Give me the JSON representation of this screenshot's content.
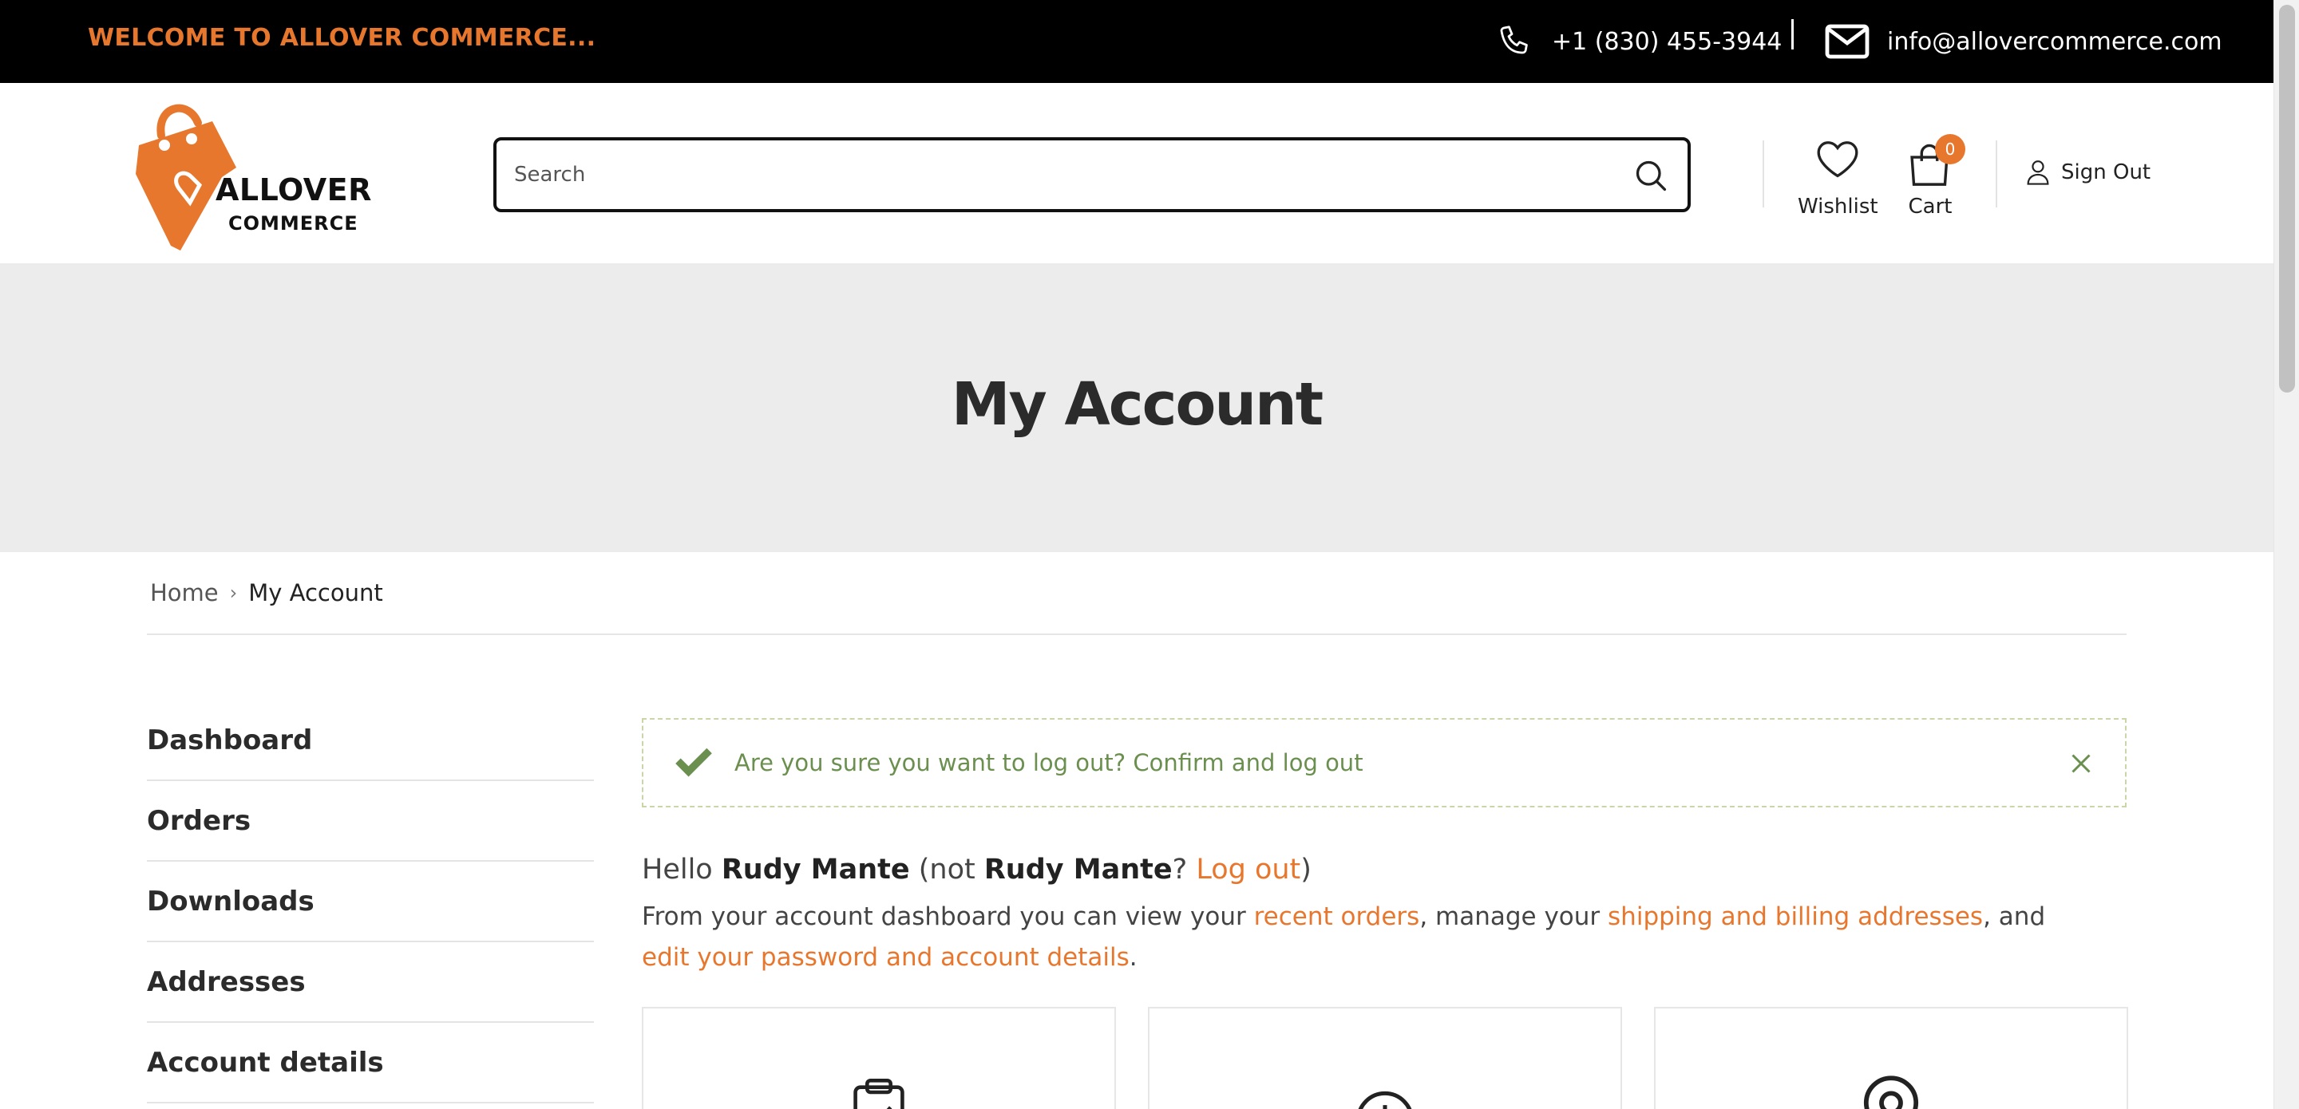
{
  "topbar": {
    "welcome": "WELCOME TO ALLOVER COMMERCE...",
    "phone": "+1 (830) 455-3944",
    "email": "info@allovercommerce.com"
  },
  "brand": {
    "name_line1": "ALLOVER",
    "name_line2": "COMMERCE",
    "accent_color": "#e8772e"
  },
  "search": {
    "placeholder": "Search",
    "value": ""
  },
  "header_actions": {
    "wishlist_label": "Wishlist",
    "cart_label": "Cart",
    "cart_count": "0",
    "signout_label": "Sign Out"
  },
  "hero": {
    "title": "My Account"
  },
  "breadcrumb": {
    "home": "Home",
    "current": "My Account"
  },
  "sidebar": {
    "items": [
      {
        "label": "Dashboard"
      },
      {
        "label": "Orders"
      },
      {
        "label": "Downloads"
      },
      {
        "label": "Addresses"
      },
      {
        "label": "Account details"
      }
    ]
  },
  "notice": {
    "prefix": "Are you sure you want to log out? ",
    "link": "Confirm and log out",
    "color": "#6b8f4e"
  },
  "greeting": {
    "hello": "Hello ",
    "name": "Rudy Mante",
    "not_prefix": " (not ",
    "not_name": "Rudy Mante",
    "question": "? ",
    "logout_link": "Log out",
    "close_paren": ")"
  },
  "intro": {
    "part1": "From your account dashboard you can view your ",
    "link_orders": "recent orders",
    "part2": ", manage your ",
    "link_addresses": "shipping and billing addresses",
    "part3": ", and ",
    "link_account": "edit your password and account details",
    "part4": "."
  },
  "cards": [
    {
      "icon": "clipboard-check-icon"
    },
    {
      "icon": "download-icon"
    },
    {
      "icon": "map-pin-icon"
    }
  ]
}
